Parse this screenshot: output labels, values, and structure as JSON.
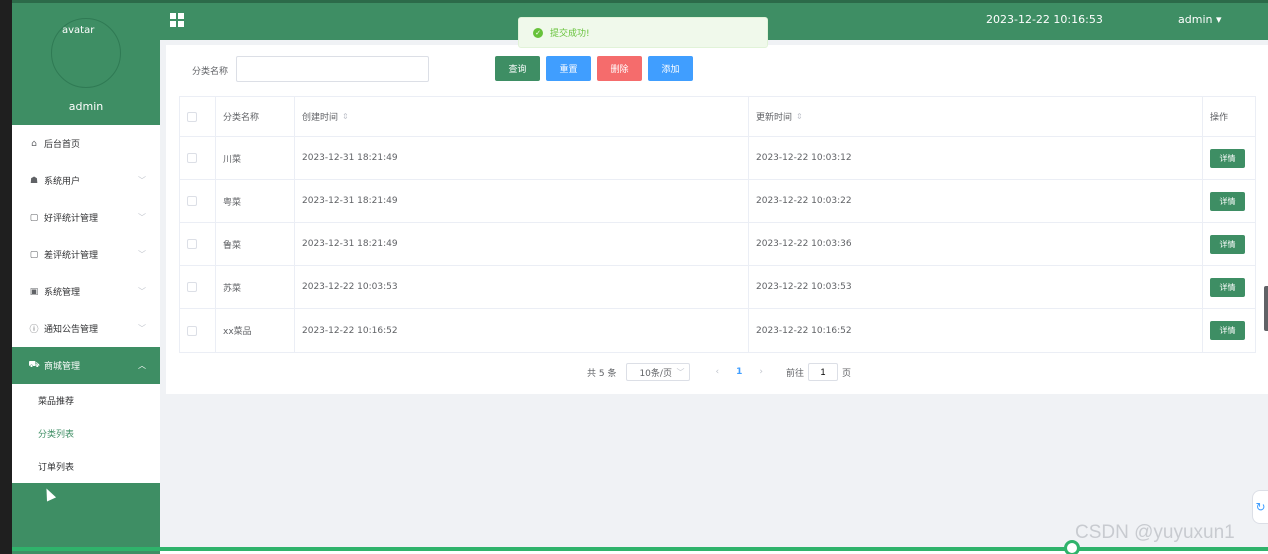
{
  "sidebar": {
    "avatar_alt": "avatar",
    "username": "admin",
    "items": [
      {
        "label": "后台首页",
        "icon": "home-icon"
      },
      {
        "label": "系统用户",
        "icon": "user-icon"
      },
      {
        "label": "好评统计管理",
        "icon": "document-icon"
      },
      {
        "label": "差评统计管理",
        "icon": "document-icon"
      },
      {
        "label": "系统管理",
        "icon": "image-icon"
      },
      {
        "label": "通知公告管理",
        "icon": "info-icon"
      },
      {
        "label": "商城管理",
        "icon": "cart-icon"
      }
    ],
    "submenu": [
      {
        "label": "菜品推荐"
      },
      {
        "label": "分类列表"
      },
      {
        "label": "订单列表"
      }
    ]
  },
  "header": {
    "title": "",
    "datetime": "2023-12-22 10:16:53",
    "user": "admin"
  },
  "toast": {
    "message": "提交成功!"
  },
  "search": {
    "label": "分类名称",
    "value": "",
    "placeholder": "",
    "buttons": {
      "query": "查询",
      "reset": "重置",
      "delete": "删除",
      "add": "添加"
    }
  },
  "table": {
    "headers": {
      "name": "分类名称",
      "created": "创建时间",
      "updated": "更新时间",
      "actions": "操作"
    },
    "rows": [
      {
        "name": "川菜",
        "created": "2023-12-31 18:21:49",
        "updated": "2023-12-22 10:03:12",
        "action": "详情"
      },
      {
        "name": "粤菜",
        "created": "2023-12-31 18:21:49",
        "updated": "2023-12-22 10:03:22",
        "action": "详情"
      },
      {
        "name": "鲁菜",
        "created": "2023-12-31 18:21:49",
        "updated": "2023-12-22 10:03:36",
        "action": "详情"
      },
      {
        "name": "苏菜",
        "created": "2023-12-22 10:03:53",
        "updated": "2023-12-22 10:03:53",
        "action": "详情"
      },
      {
        "name": "xx菜品",
        "created": "2023-12-22 10:16:52",
        "updated": "2023-12-22 10:16:52",
        "action": "详情"
      }
    ]
  },
  "pagination": {
    "total": "共 5 条",
    "page_size": "10条/页",
    "current_page": "1",
    "goto_label": "前往",
    "goto_value": "1",
    "page_suffix": "页"
  },
  "watermark": "CSDN @yuyuxun1",
  "colors": {
    "primary": "#3e8e64",
    "blue": "#409eff",
    "danger": "#f56c6c",
    "success": "#67c23a"
  }
}
